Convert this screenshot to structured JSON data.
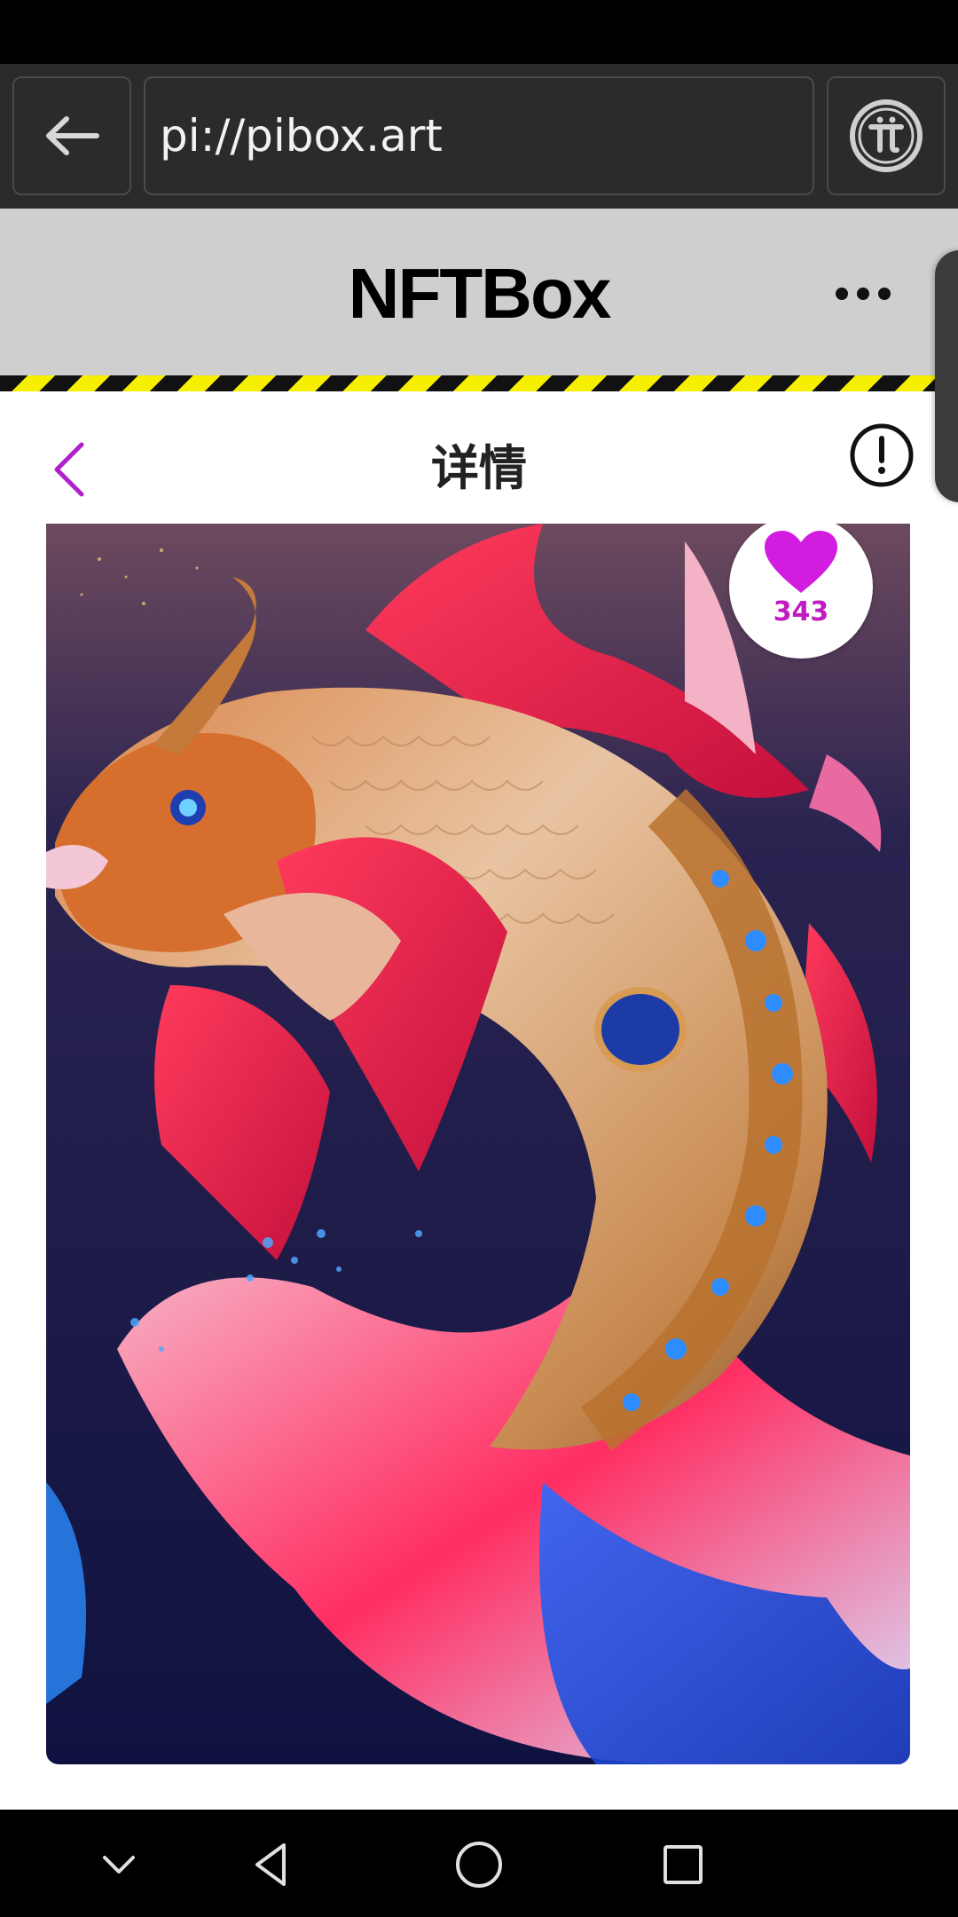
{
  "browser": {
    "url": "pi://pibox.art",
    "back_icon": "arrow-left-icon",
    "pi_icon": "pi-logo-icon"
  },
  "app": {
    "title": "NFTBox",
    "more_icon": "more-horizontal-icon"
  },
  "page": {
    "title": "详情",
    "back_icon": "chevron-left-icon",
    "info_icon": "alert-circle-icon",
    "accent_color": "#b01fc9"
  },
  "artwork": {
    "likes": "343",
    "like_icon": "heart-icon",
    "like_color": "#d21ce0"
  },
  "system_nav": {
    "icons": [
      "chevron-down-icon",
      "back-triangle-icon",
      "home-circle-icon",
      "recents-square-icon"
    ]
  }
}
